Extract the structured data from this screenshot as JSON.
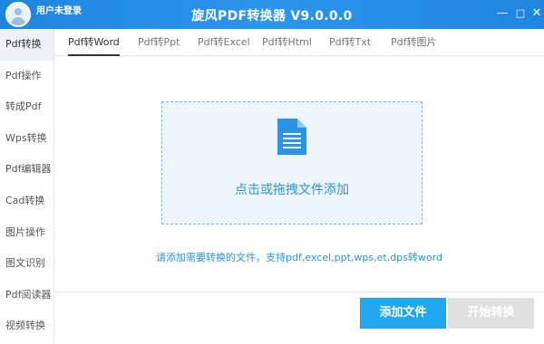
{
  "app": {
    "title": "旋风PDF转换器 V9.0.0.0",
    "user_label": "用户未登录"
  },
  "window_controls": {
    "minimize": "—",
    "maximize": "□",
    "close": "✕"
  },
  "sidebar": {
    "items": [
      {
        "label": "Pdf转换",
        "active": true
      },
      {
        "label": "Pdf操作"
      },
      {
        "label": "转成Pdf"
      },
      {
        "label": "Wps转换"
      },
      {
        "label": "Pdf编辑器"
      },
      {
        "label": "Cad转换"
      },
      {
        "label": "图片操作"
      },
      {
        "label": "图文识别"
      },
      {
        "label": "Pdf阅读器"
      },
      {
        "label": "视频转换"
      }
    ]
  },
  "tabs": [
    {
      "label": "Pdf转Word",
      "active": true
    },
    {
      "label": "Pdf转Ppt"
    },
    {
      "label": "Pdf转Excel"
    },
    {
      "label": "Pdf转Html"
    },
    {
      "label": "Pdf转Txt"
    },
    {
      "label": "Pdf转图片"
    }
  ],
  "dropzone": {
    "text": "点击或拖拽文件添加",
    "icon": "document-icon"
  },
  "hint": "请添加需要转换的文件，支持pdf,excel,ppt,wps,et,dps转word",
  "buttons": {
    "add": "添加文件",
    "start": "开始转换"
  },
  "colors": {
    "accent": "#2a93e6",
    "titlebar": "#1f86e0",
    "add_button": "#1fa8ef",
    "disabled_button": "#e0e0e0"
  }
}
